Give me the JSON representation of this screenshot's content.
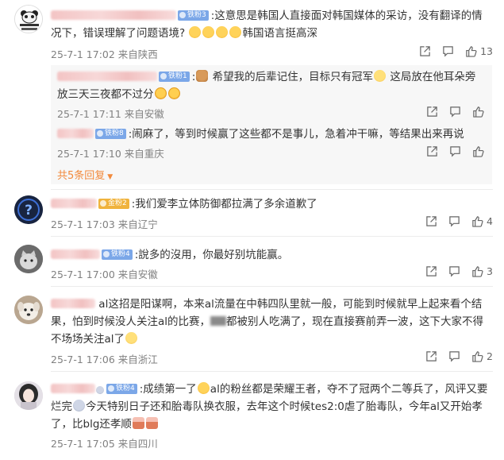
{
  "comments": [
    {
      "avatar": "panda-avatar",
      "badge": "铁粉3",
      "segments": [
        ":这意思是韩国人直接面对韩国媒体的采访，没有翻译的情况下，错误理解了问题语境? ",
        "韩国语言挺高深"
      ],
      "time": "25-7-1 17:02 来自陕西",
      "likes": "13"
    },
    {
      "avatar": "question-avatar",
      "badge": "金粉2",
      "text": ":我们爱李立体防御都拉满了多余道歉了",
      "time": "25-7-1 17:03 来自辽宁",
      "likes": "4"
    },
    {
      "avatar": "cat-avatar",
      "badge": "铁粉4",
      "text": ":說多的沒用，你最好别坑能赢。",
      "time": "25-7-1 17:00 来自安徽",
      "likes": "3"
    },
    {
      "avatar": "dog-avatar",
      "badge": "",
      "segments": [
        "al这招是阳谋啊，本来al流量在中韩四队里就一般，可能到时候就早上起来看个结果，怕到时候没人关注al的比赛，",
        "都被别人吃满了，现在直接赛前弄一波，这下大家不得不场场关注al了"
      ],
      "time": "25-7-1 17:06 来自浙江",
      "likes": "2"
    },
    {
      "avatar": "girl-avatar",
      "badge": "铁粉4",
      "segments": [
        ":成绩第一了",
        "al的粉丝都是荣耀王者，夺不了冠两个二等兵了，风评又要烂完",
        "今天特别日子还和胎毒队换衣服，去年这个时候tes2:0虐了胎毒队，今年al又开始孝了，比blg还孝顺"
      ],
      "time": "25-7-1 17:05 来自四川",
      "likes": ""
    }
  ],
  "replies": [
    {
      "badge": "铁粉1",
      "segments": [
        ":",
        " 希望我的后辈记住，目标只有冠军",
        " 这局放在他耳朵旁放三天三夜都不过分"
      ],
      "time": "25-7-1 17:11 来自安徽"
    },
    {
      "badge": "铁粉8",
      "text": ":闹麻了，等到时候赢了这些都不是事儿，急着冲干嘛，等结果出来再说",
      "time": "25-7-1 17:10 来自重庆"
    }
  ],
  "more_replies": "共5条回复",
  "colors": {
    "accent_orange": "#f28a3c",
    "meta_gray": "#808080",
    "badge_blue": "#7ba7e8",
    "badge_gold": "#f0b33d"
  }
}
